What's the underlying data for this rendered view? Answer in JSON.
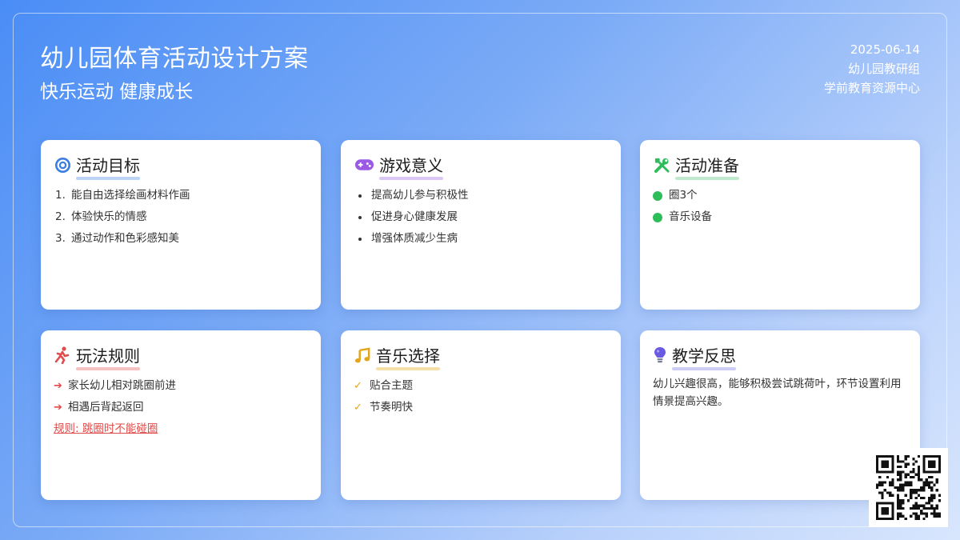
{
  "header": {
    "title": "幼儿园体育活动设计方案",
    "subtitle": "快乐运动 健康成长",
    "date": "2025-06-14",
    "group": "幼儿园教研组",
    "center": "学前教育资源中心"
  },
  "cards": {
    "goals": {
      "title": "活动目标",
      "icon": "target-icon",
      "items": [
        "能自由选择绘画材料作画",
        "体验快乐的情感",
        "通过动作和色彩感知美"
      ],
      "numbers": [
        "1.",
        "2.",
        "3."
      ]
    },
    "meaning": {
      "title": "游戏意义",
      "icon": "gamepad-icon",
      "items": [
        "提高幼儿参与积极性",
        "促进身心健康发展",
        "增强体质减少生病"
      ]
    },
    "prep": {
      "title": "活动准备",
      "icon": "tools-icon",
      "items": [
        "圈3个",
        "音乐设备"
      ]
    },
    "rules": {
      "title": "玩法规则",
      "icon": "running-icon",
      "items": [
        "家长幼儿相对跳圈前进",
        "相遇后背起返回"
      ],
      "rule": "规则: 跳圈时不能碰圈"
    },
    "music": {
      "title": "音乐选择",
      "icon": "music-note-icon",
      "items": [
        "贴合主题",
        "节奏明快"
      ]
    },
    "reflection": {
      "title": "教学反思",
      "icon": "lightbulb-icon",
      "text": "幼儿兴趣很高，能够积极尝试跳荷叶，环节设置利用情景提高兴趣。"
    }
  },
  "colors": {
    "blue": "#3d7fe0",
    "purple": "#9b59e6",
    "green": "#2dbd5a",
    "red": "#e04b4b",
    "yellow": "#e2a51b",
    "indigo": "#6a5ae0"
  }
}
